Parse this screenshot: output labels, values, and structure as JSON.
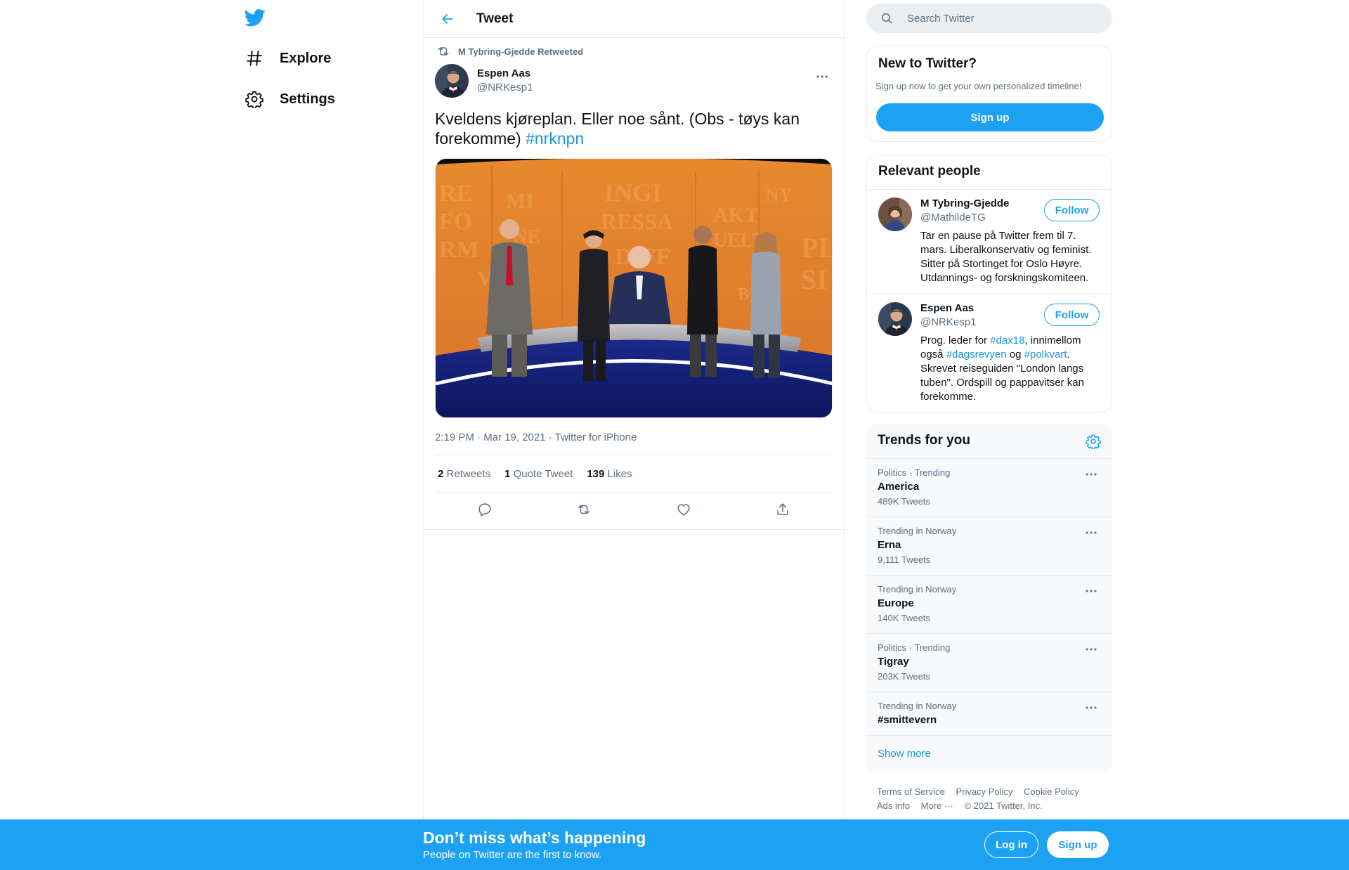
{
  "nav": {
    "logo_icon": "twitter-bird-icon",
    "items": [
      {
        "label": "Explore",
        "icon": "hashtag-icon"
      },
      {
        "label": "Settings",
        "icon": "gear-icon"
      }
    ]
  },
  "header": {
    "title": "Tweet",
    "back_icon": "arrow-left-icon"
  },
  "tweet": {
    "retweeted_by": "M Tybring-Gjedde Retweeted",
    "author_name": "Espen Aas",
    "author_handle": "@NRKesp1",
    "text": "Kveldens kjøreplan. Eller noe sånt. (Obs - tøys kan forekomme) ",
    "hashtag": "#nrknpn",
    "meta": "2:19 PM · Mar 19, 2021 · Twitter for iPhone",
    "stats": {
      "retweets_count": "2",
      "retweets_label": "Retweets",
      "quotes_count": "1",
      "quotes_label": "Quote Tweet",
      "likes_count": "139",
      "likes_label": "Likes"
    }
  },
  "search": {
    "placeholder": "Search Twitter"
  },
  "new_to_twitter": {
    "title": "New to Twitter?",
    "subtitle": "Sign up now to get your own personalized timeline!",
    "signup_label": "Sign up"
  },
  "relevant_people": {
    "title": "Relevant people",
    "people": [
      {
        "name": "M Tybring-Gjedde",
        "handle": "@MathildeTG",
        "bio": "Tar en pause på Twitter frem til 7. mars. Liberalkonservativ og feminist. Sitter på Stortinget for Oslo Høyre. Utdannings- og forskningskomiteen.",
        "follow_label": "Follow"
      },
      {
        "name": "Espen Aas",
        "handle": "@NRKesp1",
        "bio_parts": [
          "Prog. leder for ",
          "#dax18",
          ", innimellom også ",
          "#dagsrevyen",
          " og ",
          "#polkvart",
          ". Skrevet reiseguiden \"London langs tuben\". Ordspill og pappavitser kan forekomme."
        ],
        "follow_label": "Follow"
      }
    ]
  },
  "trends": {
    "title": "Trends for you",
    "items": [
      {
        "meta": "Politics · Trending",
        "name": "America",
        "count": "489K Tweets"
      },
      {
        "meta": "Trending in Norway",
        "name": "Erna",
        "count": "9,111 Tweets"
      },
      {
        "meta": "Trending in Norway",
        "name": "Europe",
        "count": "140K Tweets"
      },
      {
        "meta": "Politics · Trending",
        "name": "Tigray",
        "count": "203K Tweets"
      },
      {
        "meta": "Trending in Norway",
        "name": "#smittevern",
        "count": ""
      }
    ],
    "show_more": "Show more"
  },
  "footer": {
    "links": [
      "Terms of Service",
      "Privacy Policy",
      "Cookie Policy",
      "Ads info",
      "More ···"
    ],
    "copyright": "© 2021 Twitter, Inc."
  },
  "banner": {
    "title": "Don’t miss what’s happening",
    "subtitle": "People on Twitter are the first to know.",
    "login_label": "Log in",
    "signup_label": "Sign up"
  },
  "colors": {
    "brand": "#1da1f2",
    "link": "#1b95e0",
    "muted": "#5b7083",
    "text": "#0f1419"
  }
}
